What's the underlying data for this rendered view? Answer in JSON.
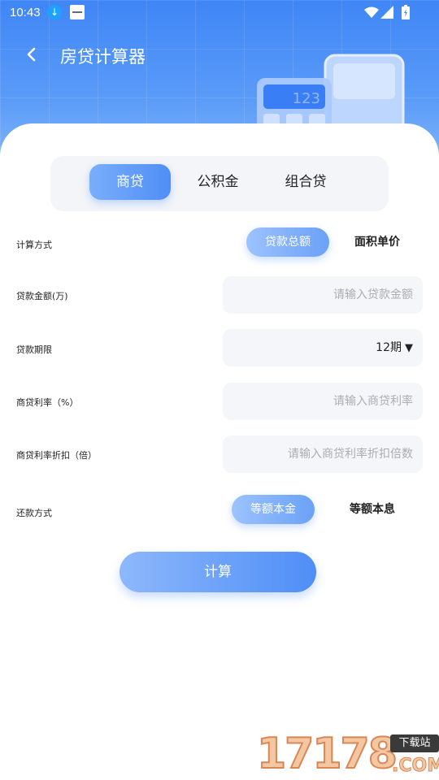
{
  "status_bar": {
    "time": "10:43"
  },
  "header": {
    "title": "房贷计算器"
  },
  "calculator_display": "123",
  "tabs": [
    {
      "label": "商贷",
      "active": true
    },
    {
      "label": "公积金",
      "active": false
    },
    {
      "label": "组合贷",
      "active": false
    }
  ],
  "form": {
    "calc_method": {
      "label": "计算方式",
      "options": [
        "贷款总额",
        "面积单价"
      ],
      "selected": "贷款总额"
    },
    "loan_amount": {
      "label": "贷款金额(万)",
      "placeholder": "请输入贷款金额"
    },
    "loan_term": {
      "label": "贷款期限",
      "value": "12期"
    },
    "interest_rate": {
      "label": "商贷利率（%）",
      "placeholder": "请输入商贷利率"
    },
    "rate_discount": {
      "label": "商贷利率折扣（倍）",
      "placeholder": "请输入商贷利率折扣倍数"
    },
    "repay_method": {
      "label": "还款方式",
      "options": [
        "等额本金",
        "等额本息"
      ],
      "selected": "等额本金"
    }
  },
  "calculate_button": "计算",
  "watermark": {
    "number": "17178",
    "badge": "下载站",
    "suffix": ".COM"
  },
  "colors": {
    "primary": "#4f8ef7",
    "header": "#3f86f6"
  }
}
